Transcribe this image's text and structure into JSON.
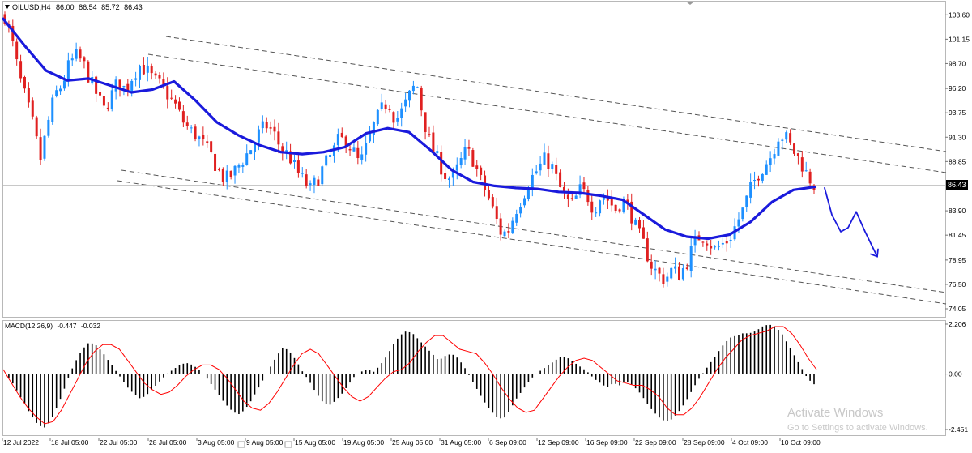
{
  "main_header": {
    "symbol": "OILUSD,H4",
    "open": "86.00",
    "high": "86.54",
    "low": "85.72",
    "close": "86.43"
  },
  "macd_header": {
    "label": "MACD(12,26,9)",
    "main": "-0.447",
    "signal": "-0.032"
  },
  "current_price_tag": "86.43",
  "watermark": {
    "title": "Activate Windows",
    "subtitle": "Go to Settings to activate Windows."
  },
  "colors": {
    "bull": "#1e90ff",
    "bear": "#e02020",
    "ma": "#1a1adc",
    "macd_hist": "#000000",
    "macd_signal": "#ff0000",
    "projection": "#1a1adc",
    "channel": "#4a4a4a"
  },
  "chart_data": [
    {
      "type": "candlestick",
      "title": "OILUSD,H4",
      "ylim": [
        74.05,
        103.95
      ],
      "y_ticks": [
        "103.60",
        "101.15",
        "98.70",
        "96.20",
        "93.75",
        "91.30",
        "88.85",
        "86.43",
        "83.90",
        "81.45",
        "78.95",
        "76.50",
        "74.05"
      ],
      "x_ticks": [
        "12 Jul 2022",
        "18 Jul 05:00",
        "22 Jul 05:00",
        "28 Jul 05:00",
        "3 Aug 05:00",
        "9 Aug 05:00",
        "15 Aug 05:00",
        "19 Aug 05:00",
        "25 Aug 05:00",
        "31 Aug 05:00",
        "6 Sep 09:00",
        "12 Sep 09:00",
        "16 Sep 09:00",
        "22 Sep 09:00",
        "28 Sep 09:00",
        "4 Oct 09:00",
        "10 Oct 09:00"
      ],
      "price_path": [
        103.5,
        101.0,
        97.5,
        95.0,
        92.5,
        89.0,
        92.5,
        95.5,
        96.5,
        98.5,
        99.5,
        98.8,
        97.0,
        95.5,
        94.0,
        95.5,
        97.0,
        96.0,
        97.5,
        98.5,
        98.0,
        97.0,
        96.5,
        95.5,
        94.5,
        93.0,
        92.0,
        91.5,
        90.5,
        89.5,
        88.0,
        87.0,
        87.5,
        88.5,
        89.5,
        90.5,
        92.0,
        92.5,
        91.5,
        90.0,
        89.5,
        88.0,
        87.0,
        86.0,
        87.0,
        88.5,
        89.5,
        91.0,
        91.0,
        90.0,
        88.5,
        90.5,
        92.5,
        94.0,
        95.0,
        93.0,
        94.0,
        95.5,
        96.8,
        93.0,
        90.5,
        89.0,
        87.5,
        87.0,
        88.5,
        90.0,
        89.0,
        87.0,
        85.5,
        83.5,
        81.5,
        82.0,
        84.0,
        85.5,
        87.0,
        88.0,
        89.0,
        88.5,
        86.5,
        85.0,
        84.5,
        86.0,
        85.5,
        84.0,
        85.5,
        85.0,
        84.0,
        85.0,
        84.0,
        82.0,
        80.5,
        78.5,
        77.5,
        77.0,
        78.0,
        77.5,
        78.5,
        80.5,
        81.5,
        81.0,
        80.0,
        80.5,
        81.0,
        82.5,
        84.0,
        86.0,
        87.5,
        88.5,
        89.5,
        91.5,
        91.3,
        90.0,
        89.0,
        87.5,
        86.5
      ],
      "ma_path": [
        103.2,
        100.5,
        98.0,
        97.0,
        97.2,
        96.5,
        95.8,
        96.1,
        96.9,
        95.0,
        92.8,
        91.5,
        90.5,
        89.8,
        89.6,
        89.8,
        90.3,
        91.7,
        92.2,
        91.8,
        90.0,
        88.0,
        86.8,
        86.4,
        86.2,
        86.1,
        85.8,
        85.7,
        85.4,
        85.0,
        83.5,
        82.0,
        81.3,
        81.1,
        81.5,
        82.8,
        84.8,
        86.0,
        86.3
      ],
      "projection_path": [
        86.2,
        83.5,
        81.8,
        82.2,
        83.8,
        81.8,
        79.3
      ],
      "macd_ylim": [
        -2.451,
        2.206
      ],
      "macd_ticks": [
        "2.206",
        "0.00",
        "-2.451"
      ],
      "macd_hist": [
        0,
        -0.3,
        -0.8,
        -1.3,
        -1.8,
        -2.2,
        -2.4,
        -2.1,
        -1.5,
        -0.8,
        0.0,
        0.6,
        1.1,
        1.4,
        1.3,
        1.0,
        0.6,
        0.2,
        -0.2,
        -0.6,
        -0.9,
        -1.1,
        -0.9,
        -0.6,
        -0.3,
        0.0,
        0.2,
        0.4,
        0.5,
        0.4,
        0.2,
        -0.1,
        -0.5,
        -0.9,
        -1.3,
        -1.6,
        -1.8,
        -1.6,
        -1.2,
        -0.7,
        -0.2,
        0.3,
        0.8,
        1.2,
        1.0,
        0.6,
        0.1,
        -0.3,
        -0.8,
        -1.2,
        -1.4,
        -1.2,
        -0.9,
        -0.5,
        -0.1,
        0.1,
        0.2,
        0.1,
        0.4,
        0.8,
        1.3,
        1.7,
        1.9,
        1.8,
        1.5,
        1.2,
        0.9,
        0.6,
        0.8,
        0.9,
        0.7,
        0.3,
        -0.2,
        -0.7,
        -1.2,
        -1.6,
        -1.9,
        -2.0,
        -1.6,
        -1.1,
        -0.7,
        -0.3,
        0.0,
        0.2,
        0.4,
        0.6,
        0.8,
        0.7,
        0.5,
        0.3,
        0.1,
        -0.2,
        -0.4,
        -0.6,
        -0.4,
        -0.5,
        -0.3,
        -0.5,
        -0.8,
        -1.2,
        -1.6,
        -1.9,
        -2.1,
        -2.0,
        -1.7,
        -1.3,
        -0.8,
        -0.3,
        0.1,
        0.5,
        0.9,
        1.3,
        1.6,
        1.7,
        1.8,
        1.8,
        1.9,
        2.1,
        2.2,
        2.1,
        1.8,
        1.3,
        0.8,
        0.3,
        -0.2,
        -0.45
      ],
      "macd_signal": [
        0.2,
        -0.4,
        -1.0,
        -1.5,
        -1.9,
        -2.2,
        -2.1,
        -1.6,
        -0.9,
        -0.2,
        0.5,
        1.0,
        1.3,
        1.3,
        1.1,
        0.6,
        0.1,
        -0.4,
        -0.7,
        -0.9,
        -0.8,
        -0.5,
        -0.1,
        0.2,
        0.4,
        0.4,
        0.2,
        -0.2,
        -0.7,
        -1.2,
        -1.5,
        -1.6,
        -1.3,
        -0.8,
        -0.2,
        0.4,
        0.9,
        1.1,
        0.9,
        0.4,
        -0.1,
        -0.6,
        -1.0,
        -1.2,
        -1.0,
        -0.6,
        -0.2,
        0.1,
        0.2,
        0.5,
        1.0,
        1.4,
        1.7,
        1.7,
        1.4,
        1.1,
        1.0,
        0.9,
        0.5,
        0.0,
        -0.6,
        -1.1,
        -1.5,
        -1.7,
        -1.6,
        -1.1,
        -0.6,
        -0.1,
        0.3,
        0.6,
        0.7,
        0.6,
        0.3,
        0.0,
        -0.3,
        -0.4,
        -0.5,
        -0.5,
        -0.7,
        -1.0,
        -1.5,
        -1.8,
        -1.8,
        -1.5,
        -1.0,
        -0.4,
        0.2,
        0.7,
        1.1,
        1.5,
        1.7,
        1.8,
        1.9,
        2.1,
        2.1,
        1.8,
        1.3,
        0.7,
        0.2
      ]
    }
  ]
}
